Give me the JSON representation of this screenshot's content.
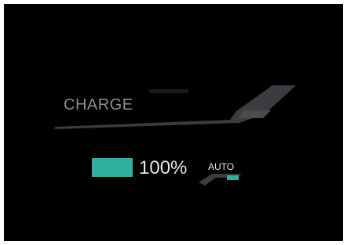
{
  "charge": {
    "label": "CHARGE",
    "level_percent": 100,
    "percent_text": "100%",
    "mode_label": "AUTO"
  },
  "colors": {
    "background": "#000000",
    "accent_teal": "#2fb1a0",
    "label_gray": "#8a8c8f",
    "stripe_gray": "#3a3c3f",
    "text_light": "#e6e6e6"
  },
  "icons": {
    "battery": "battery-icon",
    "auto_indicator": "auto-indicator-icon"
  }
}
